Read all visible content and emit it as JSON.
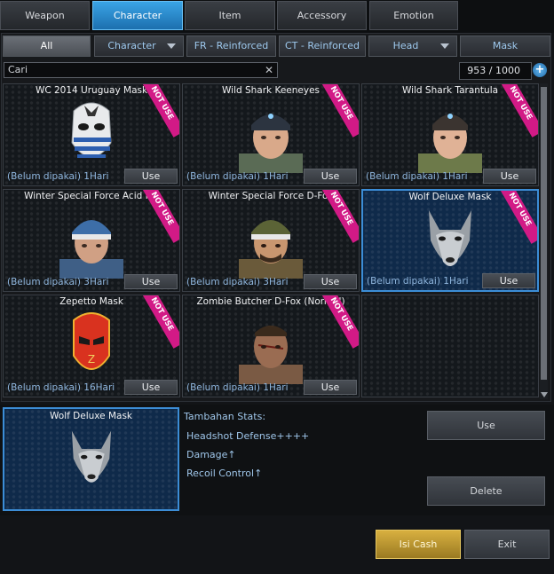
{
  "tabs": [
    {
      "label": "Weapon",
      "active": false
    },
    {
      "label": "Character",
      "active": true
    },
    {
      "label": "Item",
      "active": false
    },
    {
      "label": "Accessory",
      "active": false
    },
    {
      "label": "Emotion",
      "active": false
    }
  ],
  "filters": {
    "all": "All",
    "character": "Character",
    "fr": "FR - Reinforced",
    "ct": "CT - Reinforced",
    "head": "Head",
    "mask": "Mask"
  },
  "search": {
    "value": "Cari"
  },
  "inventory_count": "953 / 1000",
  "items": [
    {
      "name": "WC 2014 Uruguay Mask",
      "status": "(Belum dipakai) 1Hari",
      "use_label": "Use",
      "ribbon": "NOT USE"
    },
    {
      "name": "Wild Shark Keeneyes",
      "status": "(Belum dipakai) 1Hari",
      "use_label": "Use",
      "ribbon": "NOT USE"
    },
    {
      "name": "Wild Shark Tarantula",
      "status": "(Belum dipakai) 1Hari",
      "use_label": "Use",
      "ribbon": "NOT USE"
    },
    {
      "name": "Winter Special Force Acid Pol",
      "status": "(Belum dipakai) 3Hari",
      "use_label": "Use",
      "ribbon": "NOT USE"
    },
    {
      "name": "Winter Special Force D-Fox",
      "status": "(Belum dipakai) 3Hari",
      "use_label": "Use",
      "ribbon": "NOT USE"
    },
    {
      "name": "Wolf Deluxe Mask",
      "status": "(Belum dipakai) 1Hari",
      "use_label": "Use",
      "ribbon": "NOT USE"
    },
    {
      "name": "Zepetto Mask",
      "status": "(Belum dipakai) 16Hari",
      "use_label": "Use",
      "ribbon": "NOT USE"
    },
    {
      "name": "Zombie Butcher D-Fox (Normal)",
      "status": "(Belum dipakai) 1Hari",
      "use_label": "Use",
      "ribbon": "NOT USE"
    }
  ],
  "selected": {
    "name": "Wolf Deluxe Mask",
    "stats_title": "Tambahan Stats:",
    "stats": [
      "Headshot Defense++++",
      "Damage↑",
      "Recoil Control↑"
    ]
  },
  "buttons": {
    "use": "Use",
    "delete": "Delete",
    "isi_cash": "Isi Cash",
    "exit": "Exit"
  },
  "colors": {
    "accent": "#3c8dd6",
    "ribbon": "#d21a86",
    "cash": "#d8b040"
  }
}
